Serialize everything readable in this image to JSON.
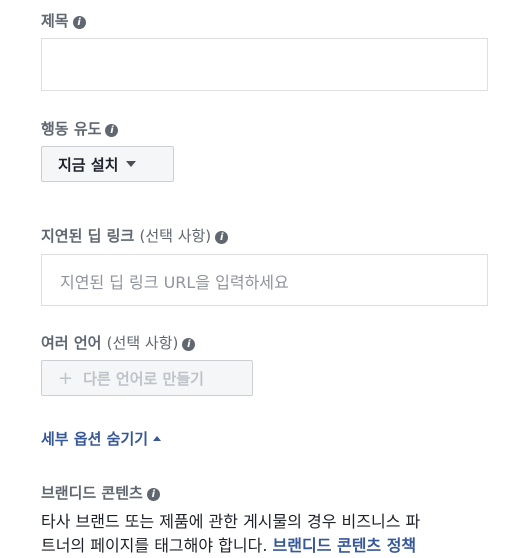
{
  "title_field": {
    "label": "제목",
    "value": ""
  },
  "cta_field": {
    "label": "행동 유도",
    "selected": "지금 설치"
  },
  "deep_link_field": {
    "label": "지연된 딥 링크",
    "optional": "(선택 사항)",
    "placeholder": "지연된 딥 링크 URL을 입력하세요"
  },
  "languages_field": {
    "label": "여러 언어",
    "optional": "(선택 사항)",
    "button_icon": "+",
    "button_label": "다른 언어로 만들기"
  },
  "hide_options_link": "세부 옵션 숨기기",
  "branded_content": {
    "label": "브랜디드 콘텐츠",
    "description_line1": "타사 브랜드 또는 제품에 관한 게시물의 경우 비즈니스 파",
    "description_line2": "트너의 페이지를 태그해야 합니다.",
    "policy_link": "브랜디드 콘텐츠 정책"
  },
  "colors": {
    "label": "#606770",
    "link": "#365899",
    "border": "#dddfe2",
    "button_bg": "#f5f6f7",
    "placeholder": "#90949c"
  },
  "icons": {
    "info": "info-icon",
    "dropdown": "caret-down-icon",
    "collapse": "caret-up-icon",
    "add": "plus-icon"
  }
}
